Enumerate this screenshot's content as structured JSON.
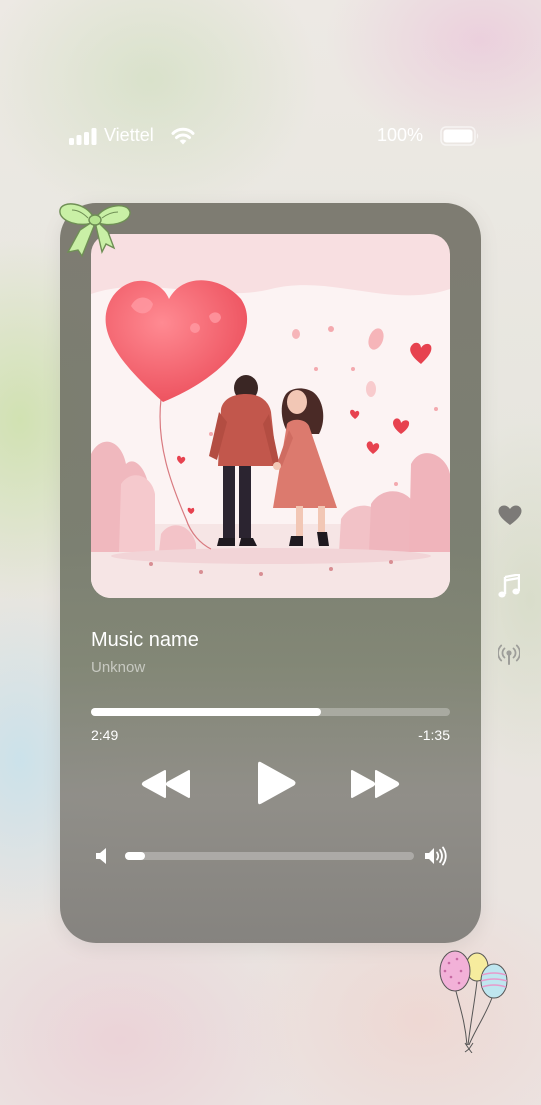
{
  "status_bar": {
    "carrier": "Viettel",
    "battery_percent": "100%",
    "icons": [
      "signal-bars-icon",
      "wifi-icon",
      "battery-icon"
    ]
  },
  "player": {
    "track_title": "Music name",
    "artist": "Unknow",
    "elapsed": "2:49",
    "remaining": "-1:35",
    "progress_fraction": 0.64,
    "volume_fraction": 0.07,
    "controls": [
      "rewind-icon",
      "play-icon",
      "fast-forward-icon"
    ],
    "volume_icons": [
      "volume-low-icon",
      "volume-high-icon"
    ]
  },
  "side_actions": [
    "heart-icon",
    "music-note-icon",
    "airplay-icon"
  ],
  "decorations": [
    "green-bow",
    "balloons"
  ],
  "colors": {
    "card": "#7b7a70",
    "track_inactive": "rgba(255,255,255,0.28)",
    "track_active": "#ffffff",
    "artwork_pink": "#f7d9dc",
    "heart_red": "#ef5b67"
  }
}
